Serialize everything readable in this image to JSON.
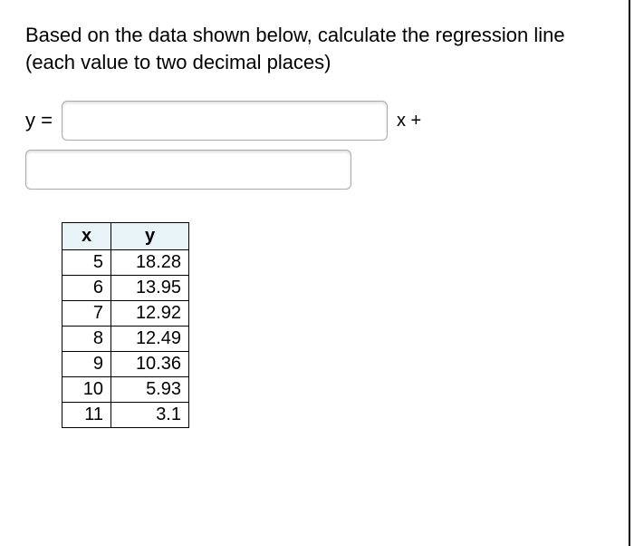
{
  "prompt": "Based on the data shown below, calculate the regression line (each value to two decimal places)",
  "equation": {
    "y_label": "y =",
    "x_plus": "x +"
  },
  "inputs": {
    "slope": "",
    "intercept": ""
  },
  "chart_data": {
    "type": "table",
    "headers": {
      "x": "x",
      "y": "y"
    },
    "rows": [
      {
        "x": "5",
        "y": "18.28"
      },
      {
        "x": "6",
        "y": "13.95"
      },
      {
        "x": "7",
        "y": "12.92"
      },
      {
        "x": "8",
        "y": "12.49"
      },
      {
        "x": "9",
        "y": "10.36"
      },
      {
        "x": "10",
        "y": "5.93"
      },
      {
        "x": "11",
        "y": "3.1"
      }
    ]
  }
}
